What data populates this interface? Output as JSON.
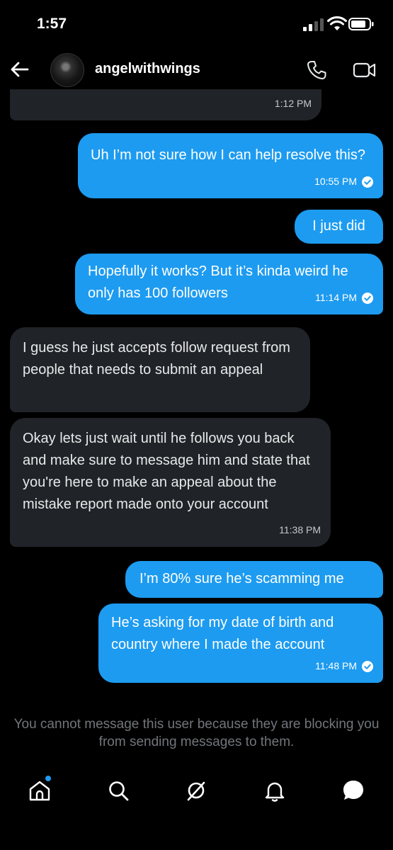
{
  "status_bar": {
    "time": "1:57"
  },
  "header": {
    "username": "angelwithwings"
  },
  "messages": [
    {
      "dir": "in",
      "text": "",
      "time": "1:12 PM"
    },
    {
      "dir": "out",
      "text": "Uh I’m not sure how I can help resolve this?",
      "time": "10:55 PM"
    },
    {
      "dir": "out",
      "text": "I just did",
      "time": ""
    },
    {
      "dir": "out",
      "text": "Hopefully it works? But it’s kinda weird he only has 100 followers",
      "time": "11:14 PM"
    },
    {
      "dir": "in",
      "text": "I guess he just accepts follow request from people that needs to submit an appeal",
      "time": ""
    },
    {
      "dir": "in",
      "text": "Okay lets just wait until he follows you back and make sure to message him and state that you're here to make an appeal about the mistake report made onto your account",
      "time": "11:38 PM"
    },
    {
      "dir": "out",
      "text": "I’m 80% sure he’s scamming me",
      "time": ""
    },
    {
      "dir": "out",
      "text": "He’s asking for my date of birth and country where I made the account",
      "time": "11:48 PM"
    }
  ],
  "blocked_notice": "You cannot message this user because they are blocking you from sending messages to them.",
  "tabbar": {
    "icons": [
      "home-icon",
      "search-icon",
      "grok-icon",
      "notifications-icon",
      "messages-icon"
    ]
  },
  "colors": {
    "accent": "#1d9bf0",
    "incoming_bubble": "#202327",
    "background": "#000000"
  }
}
